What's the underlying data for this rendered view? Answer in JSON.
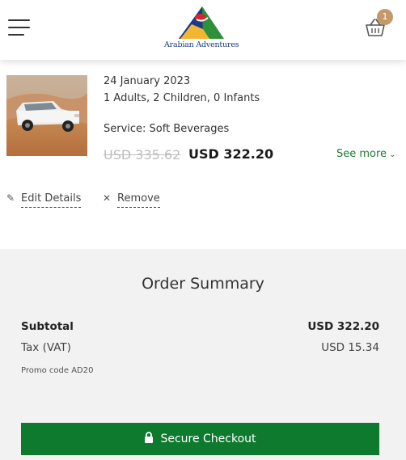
{
  "header": {
    "menu_icon": "hamburger-menu-icon",
    "logo_text": "Arabian Adventures",
    "cart_icon": "shopping-basket-icon",
    "cart_count": "1",
    "colors": {
      "logo_blue": "#1d3a8a",
      "logo_green": "#2f8f3a",
      "logo_yellow": "#f2b632",
      "logo_red": "#d6262b",
      "badge": "#c4996a"
    }
  },
  "cart_item": {
    "image": "desert-safari-suv-photo",
    "date": "24 January 2023",
    "guests": "1 Adults, 2 Children, 0 Infants",
    "service": "Service: Soft Beverages",
    "old_price": "USD 335.62",
    "price": "USD 322.20",
    "see_more": "See more",
    "edit_label": "Edit Details",
    "remove_label": "Remove"
  },
  "summary": {
    "title": "Order Summary",
    "subtotal_label": "Subtotal",
    "subtotal_value": "USD 322.20",
    "tax_label": "Tax (VAT)",
    "tax_value": "USD 15.34",
    "promo": "Promo code AD20",
    "checkout_label": "Secure Checkout",
    "colors": {
      "checkout_green": "#0e7a2e",
      "background": "#f2f2f2",
      "link_green": "#1a7a33"
    }
  }
}
